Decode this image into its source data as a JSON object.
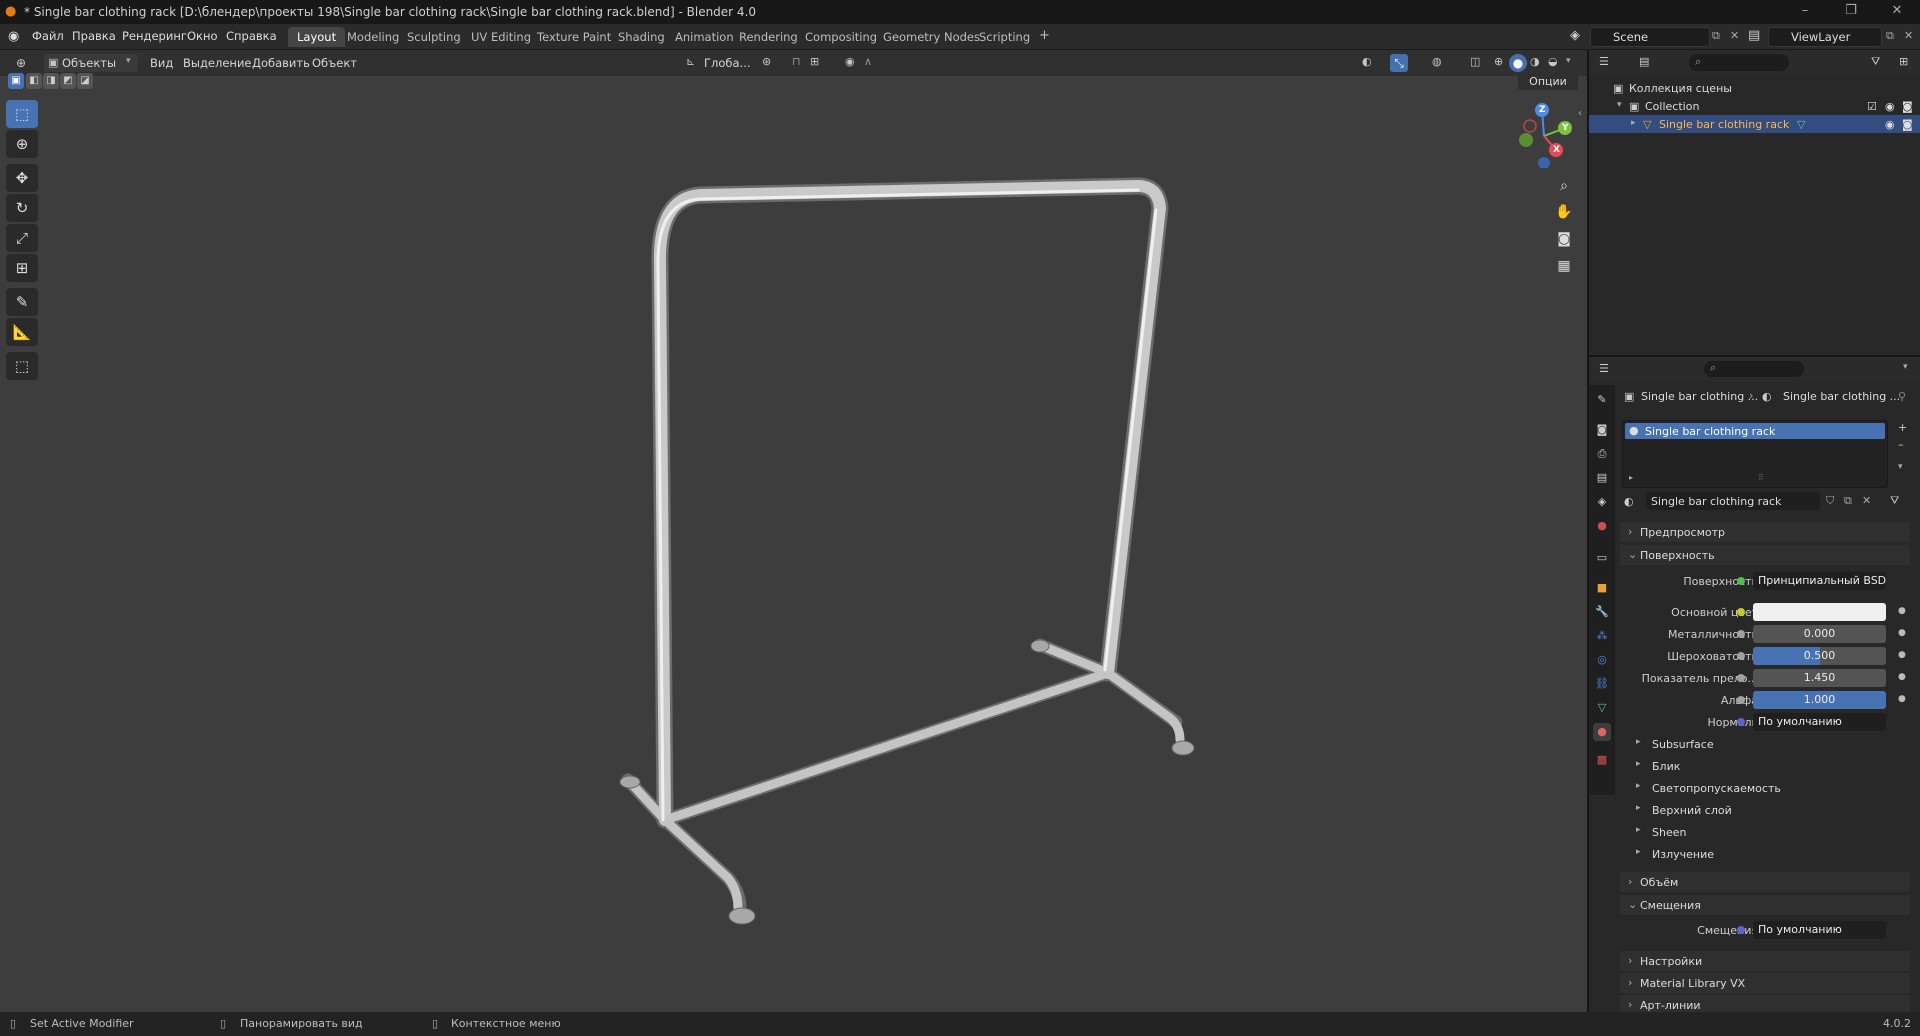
{
  "window": {
    "title": "* Single bar clothing rack [D:\\блендер\\проекты 198\\Single bar clothing rack\\Single bar clothing rack.blend] - Blender 4.0",
    "minimize": "–",
    "maximize": "❐",
    "close": "✕"
  },
  "menu": {
    "file": "Файл",
    "edit": "Правка",
    "render": "Рендеринг",
    "window": "Окно",
    "help": "Справка"
  },
  "workspaces": [
    "Layout",
    "Modeling",
    "Sculpting",
    "UV Editing",
    "Texture Paint",
    "Shading",
    "Animation",
    "Rendering",
    "Compositing",
    "Geometry Nodes",
    "Scripting"
  ],
  "active_workspace": "Layout",
  "add_workspace": "+",
  "scene": {
    "name": "Scene"
  },
  "view_layer": {
    "name": "ViewLayer"
  },
  "viewport_header": {
    "mode": "Объекты",
    "view": "Вид",
    "select": "Выделение",
    "add": "Добавить",
    "object": "Объект",
    "transform_orientation": "Глоба...",
    "options": "Опции"
  },
  "gizmo": {
    "x": "X",
    "y": "Y",
    "z": "Z"
  },
  "outliner": {
    "scene_collection": "Коллекция сцены",
    "collection": "Collection",
    "object": "Single bar clothing rack"
  },
  "properties": {
    "breadcrumb_object": "Single bar clothing ...",
    "breadcrumb_material": "Single bar clothing ...",
    "slot_name": "Single bar clothing rack",
    "material_name": "Single bar clothing rack",
    "sections": {
      "preview": "Предпросмотр",
      "surface": "Поверхность",
      "volume": "Объём",
      "displacement": "Смещения",
      "settings": "Настройки",
      "material_library": "Material Library VX",
      "line_art": "Арт-линии"
    },
    "surface_label": "Поверхность",
    "surface_shader": "Принципиальный BSDF",
    "base_color_label": "Основной цвет",
    "metallic_label": "Металличность",
    "metallic_value": "0.000",
    "roughness_label": "Шероховатость",
    "roughness_value": "0.500",
    "roughness_fill": 0.5,
    "ior_label": "Показатель прело...",
    "ior_value": "1.450",
    "alpha_label": "Альфа",
    "alpha_value": "1.000",
    "alpha_fill": 1.0,
    "normal_label": "Нормаль",
    "normal_value": "По умолчанию",
    "subpanels": [
      "Subsurface",
      "Блик",
      "Светопропускаемость",
      "Верхний слой",
      "Sheen",
      "Излучение"
    ],
    "displacement_label": "Смещения",
    "displacement_value": "По умолчанию",
    "base_color_hex": "#f0f0f0"
  },
  "status": {
    "left": "Set Active Modifier",
    "middle": "Панорамировать вид",
    "right": "Контекстное меню",
    "version": "4.0.2"
  }
}
